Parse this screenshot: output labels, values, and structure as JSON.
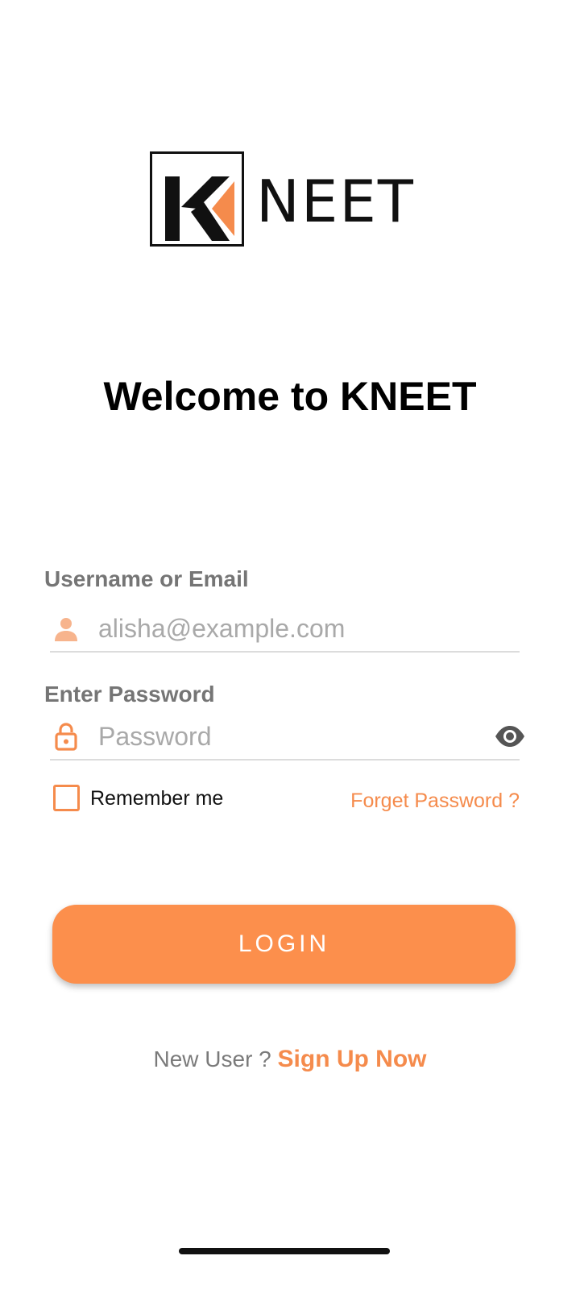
{
  "brand": {
    "wordmark": "NEET",
    "accent_color": "#fc8f4c"
  },
  "title": "Welcome to KNEET",
  "form": {
    "username": {
      "label": "Username or Email",
      "placeholder": "alisha@example.com",
      "value": "",
      "icon": "person-icon"
    },
    "password": {
      "label": "Enter Password",
      "placeholder": "Password",
      "value": "",
      "icon": "lock-icon",
      "toggle_icon": "eye-icon"
    },
    "remember_label": "Remember me",
    "remember_checked": false,
    "forget_link": "Forget Password ?"
  },
  "login_button": "LOGIN",
  "signup": {
    "prompt": "New User ?",
    "link": "Sign Up Now"
  }
}
